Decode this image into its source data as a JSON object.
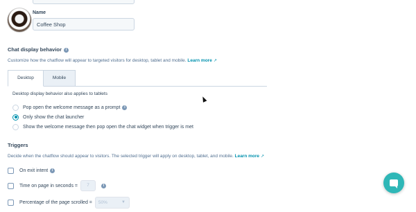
{
  "profile": {
    "name_label": "Name",
    "name_value": "Coffee Shop"
  },
  "chat_display": {
    "title": "Chat display behavior",
    "description": "Customize how the chatflow will appear to targeted visitors for desktop, tablet and mobile.",
    "learn_more": "Learn more",
    "tabs": [
      {
        "label": "Desktop",
        "active": true
      },
      {
        "label": "Mobile",
        "active": false
      }
    ],
    "tab_note": "Desktop display behavior also applies to tablets",
    "options": [
      {
        "label": "Pop open the welcome message as a prompt",
        "checked": false,
        "info": true
      },
      {
        "label": "Only show the chat launcher",
        "checked": true,
        "info": false
      },
      {
        "label": "Show the welcome message then pop open the chat widget when trigger is met",
        "checked": false,
        "info": false
      }
    ]
  },
  "triggers": {
    "title": "Triggers",
    "description": "Decide when the chatflow should appear to visitors. The selected trigger will apply on desktop, tablet, and mobile.",
    "learn_more": "Learn more",
    "items": [
      {
        "label": "On exit intent"
      },
      {
        "label": "Time on page in seconds =",
        "value": "7"
      },
      {
        "label": "Percentage of the page scrolled =",
        "value": "50%"
      }
    ]
  },
  "colors": {
    "accent": "#0091ae",
    "chat_launcher": "#2fb7b7",
    "text": "#33475b"
  },
  "icons": [
    "info-icon",
    "external-link-icon",
    "chat-launcher-icon",
    "chevron-down-icon"
  ]
}
